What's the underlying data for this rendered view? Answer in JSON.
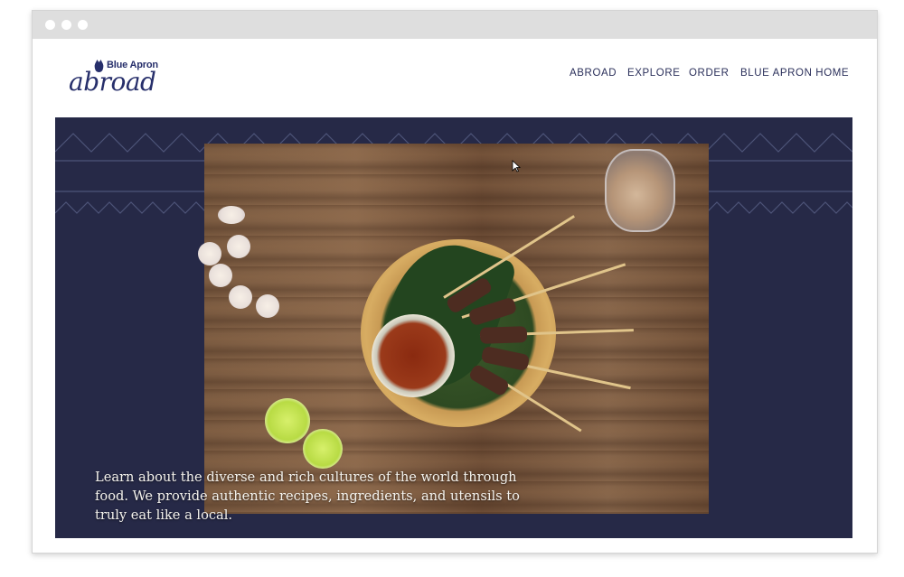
{
  "logo": {
    "brand": "Blue Apron",
    "name": "abroad"
  },
  "nav": {
    "items": [
      "ABROAD",
      "EXPLORE",
      "ORDER",
      "BLUE APRON HOME"
    ]
  },
  "hero": {
    "text": "Learn about the diverse and rich cultures of the world through food. We provide authentic recipes, ingredients, and utensils to truly eat like a local."
  },
  "colors": {
    "brand": "#272f6b",
    "hero_bg": "#262947",
    "chrome": "#dedede"
  }
}
